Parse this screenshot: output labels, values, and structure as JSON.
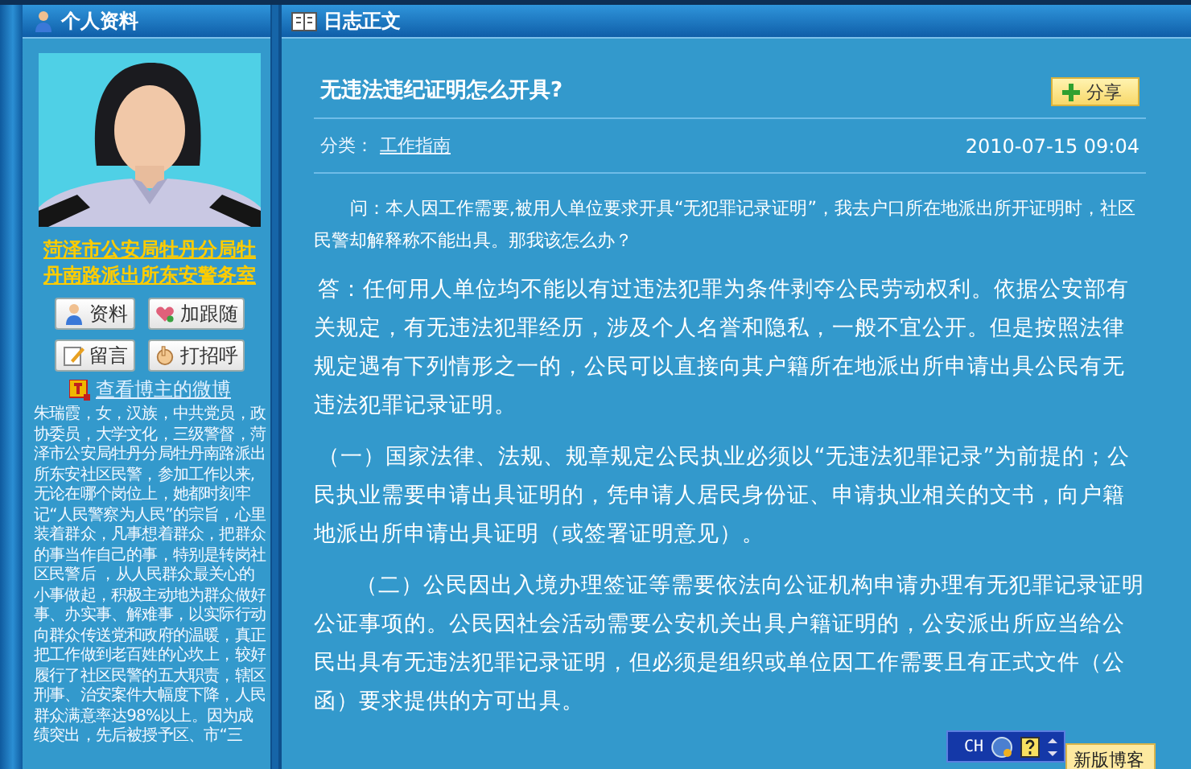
{
  "sidebar": {
    "title": "个人资料",
    "profile_link": "菏泽市公安局牡丹分局牡丹南路派出所东安警务室",
    "buttons": [
      {
        "label": "资料",
        "kind": "profile"
      },
      {
        "label": "加跟随",
        "kind": "follow"
      },
      {
        "label": "留言",
        "kind": "message"
      },
      {
        "label": "打招呼",
        "kind": "greet"
      }
    ],
    "weibo_link": "查看博主的微博",
    "bio": "朱瑞霞，女，汉族，中共党员，政协委员，大学文化，三级警督，菏泽市公安局牡丹分局牡丹南路派出所东安社区民警，参加工作以来,无论在哪个岗位上，她都时刻牢记“人民警察为人民”的宗旨，心里装着群众，凡事想着群众，把群众的事当作自己的事，特别是转岗社区民警后 ，从人民群众最关心的小事做起，积极主动地为群众做好事、办实事、解难事，以实际行动向群众传送党和政府的温暖，真正把工作做到老百姓的心坎上，较好履行了社区民警的五大职责，辖区刑事、治安案件大幅度下降，人民群众满意率达98%以上。因为成绩突出，先后被授予区、市“三"
  },
  "article_panel": {
    "title": "日志正文",
    "post": {
      "heading": "无违法违纪证明怎么开具?",
      "share_button": "分享",
      "category_label": "分类：",
      "category": "工作指南",
      "date": "2010-07-15 09:04",
      "paragraphs": [
        {
          "kind": "question",
          "text": "问：本人因工作需要,被用人单位要求开具“无犯罪记录证明”，我去户口所在地派出所开证明时，社区民警却解释称不能出具。那我该怎么办？"
        },
        {
          "kind": "answer",
          "text": "答：任何用人单位均不能以有过违法犯罪为条件剥夺公民劳动权利。依据公安部有关规定，有无违法犯罪经历，涉及个人名誉和隐私，一般不宜公开。但是按照法律规定遇有下列情形之一的，公民可以直接向其户籍所在地派出所申请出具公民有无违法犯罪记录证明。"
        },
        {
          "kind": "answer",
          "text": "（一）国家法律、法规、规章规定公民执业必须以“无违法犯罪记录”为前提的；公民执业需要申请出具证明的，凭申请人居民身份证、申请执业相关的文书，向户籍地派出所申请出具证明（或签署证明意见）。"
        },
        {
          "kind": "indented",
          "text": "（二）公民因出入境办理签证等需要依法向公证机构申请办理有无犯罪记录证明公证事项的。公民因社会活动需要公安机关出具户籍证明的，公安派出所应当给公民出具有无违法犯罪记录证明，但必须是组织或单位因工作需要且有正式文件（公函）要求提供的方可出具。"
        }
      ]
    },
    "new_blog_button": "新版博客"
  },
  "ime_toolbar": {
    "language": "CH"
  }
}
